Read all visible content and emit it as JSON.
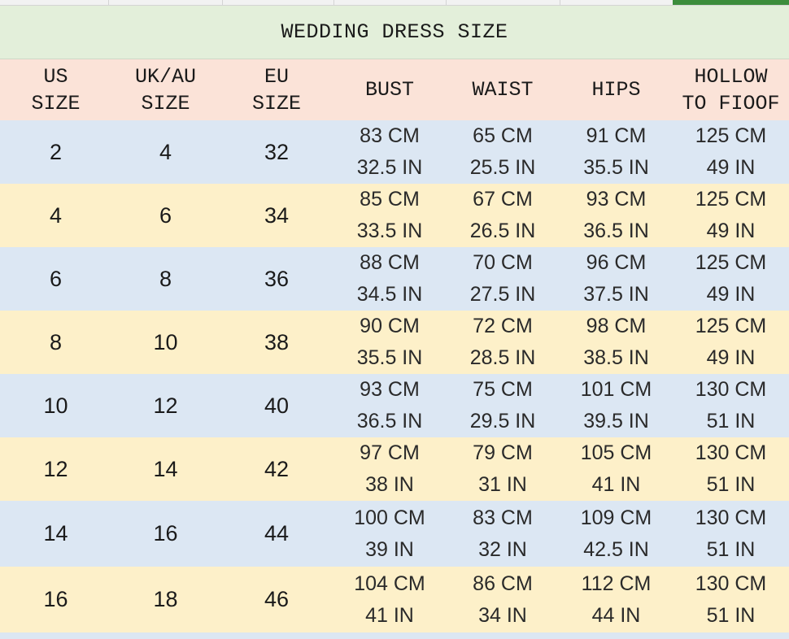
{
  "title": "WEDDING DRESS SIZE",
  "headers": [
    [
      "US",
      "SIZE"
    ],
    [
      "UK/AU",
      "SIZE"
    ],
    [
      "EU",
      "SIZE"
    ],
    [
      "BUST"
    ],
    [
      "WAIST"
    ],
    [
      "HIPS"
    ],
    [
      "HOLLOW",
      "TO FIOOF"
    ]
  ],
  "rows": [
    {
      "us": "2",
      "uk": "4",
      "eu": "32",
      "bust": [
        "83 CM",
        "32.5 IN"
      ],
      "waist": [
        "65 CM",
        "25.5 IN"
      ],
      "hips": [
        "91 CM",
        "35.5 IN"
      ],
      "hollow": [
        "125 CM",
        "49 IN"
      ]
    },
    {
      "us": "4",
      "uk": "6",
      "eu": "34",
      "bust": [
        "85 CM",
        "33.5 IN"
      ],
      "waist": [
        "67 CM",
        "26.5 IN"
      ],
      "hips": [
        "93 CM",
        "36.5 IN"
      ],
      "hollow": [
        "125 CM",
        "49 IN"
      ]
    },
    {
      "us": "6",
      "uk": "8",
      "eu": "36",
      "bust": [
        "88 CM",
        "34.5 IN"
      ],
      "waist": [
        "70 CM",
        "27.5 IN"
      ],
      "hips": [
        "96 CM",
        "37.5 IN"
      ],
      "hollow": [
        "125 CM",
        "49 IN"
      ]
    },
    {
      "us": "8",
      "uk": "10",
      "eu": "38",
      "bust": [
        "90 CM",
        "35.5 IN"
      ],
      "waist": [
        "72 CM",
        "28.5 IN"
      ],
      "hips": [
        "98 CM",
        "38.5 IN"
      ],
      "hollow": [
        "125 CM",
        "49 IN"
      ]
    },
    {
      "us": "10",
      "uk": "12",
      "eu": "40",
      "bust": [
        "93 CM",
        "36.5 IN"
      ],
      "waist": [
        "75 CM",
        "29.5 IN"
      ],
      "hips": [
        "101 CM",
        "39.5 IN"
      ],
      "hollow": [
        "130 CM",
        "51 IN"
      ]
    },
    {
      "us": "12",
      "uk": "14",
      "eu": "42",
      "bust": [
        "97 CM",
        "38 IN"
      ],
      "waist": [
        "79 CM",
        "31 IN"
      ],
      "hips": [
        "105 CM",
        "41 IN"
      ],
      "hollow": [
        "130 CM",
        "51 IN"
      ]
    },
    {
      "us": "14",
      "uk": "16",
      "eu": "44",
      "bust": [
        "100 CM",
        "39 IN"
      ],
      "waist": [
        "83 CM",
        "32 IN"
      ],
      "hips": [
        "109 CM",
        "42.5 IN"
      ],
      "hollow": [
        "130 CM",
        "51 IN"
      ]
    },
    {
      "us": "16",
      "uk": "18",
      "eu": "46",
      "bust": [
        "104 CM",
        "41 IN"
      ],
      "waist": [
        "86 CM",
        "34 IN"
      ],
      "hips": [
        "112 CM",
        "44 IN"
      ],
      "hollow": [
        "130 CM",
        "51 IN"
      ]
    }
  ],
  "colors": {
    "title_bg": "#e3efda",
    "header_bg": "#fbe3d8",
    "row_blue": "#dce7f3",
    "row_yellow": "#fdf0c9",
    "selection_green": "#3c8d3c"
  }
}
